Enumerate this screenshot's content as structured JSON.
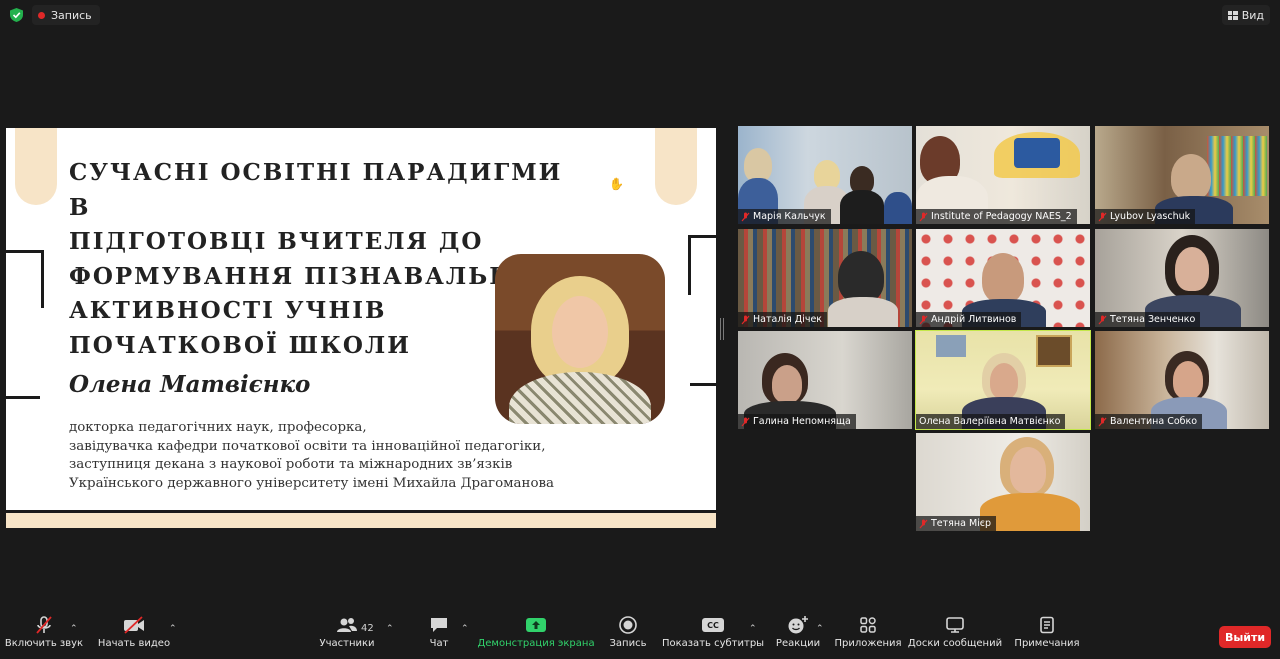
{
  "topbar": {
    "record_label": "Запись",
    "view_label": "Вид"
  },
  "slide": {
    "title_lines": [
      "СУЧАСНІ ОСВІТНІ ПАРАДИГМИ В",
      "ПІДГОТОВЦІ ВЧИТЕЛЯ ДО",
      "ФОРМУВАННЯ ПІЗНАВАЛЬНОЇ",
      "АКТИВНОСТІ УЧНІВ",
      "ПОЧАТКОВОЇ ШКОЛИ"
    ],
    "speaker_name": "Олена Матвієнко",
    "description_lines": [
      "докторка педагогічних наук, професорка,",
      "завідувачка кафедри початкової освіти та інноваційної педагогіки,",
      "заступниця декана з наукової роботи та міжнародних зв’язків",
      "Українського державного університету імені Михайла Драгоманова"
    ]
  },
  "participants": [
    {
      "name": "Марія Кальчук"
    },
    {
      "name": "Institute of Pedagogy NAES_2"
    },
    {
      "name": "Lyubov Lyaschuk"
    },
    {
      "name": "Наталія Дічек"
    },
    {
      "name": "Андрій Литвинов"
    },
    {
      "name": "Тетяна Зенченко"
    },
    {
      "name": "Галина Непомняща"
    },
    {
      "name": "Олена Валеріївна Матвієнко"
    },
    {
      "name": "Валентина Собко"
    },
    {
      "name": "Тетяна Мієр"
    }
  ],
  "toolbar": {
    "mute_label": "Включить звук",
    "video_label": "Начать видео",
    "participants_label": "Участники",
    "participants_count": "42",
    "chat_label": "Чат",
    "share_label": "Демонстрация экрана",
    "record_label": "Запись",
    "captions_label": "Показать субтитры",
    "captions_icon_text": "CC",
    "reactions_label": "Реакции",
    "apps_label": "Приложения",
    "whiteboards_label": "Доски сообщений",
    "notes_label": "Примечания",
    "leave_label": "Выйти"
  },
  "colors": {
    "accent_green": "#31d26b",
    "leave_red": "#e02828",
    "active_speaker": "#c4e84a",
    "slide_accent": "#f7e4c7"
  }
}
